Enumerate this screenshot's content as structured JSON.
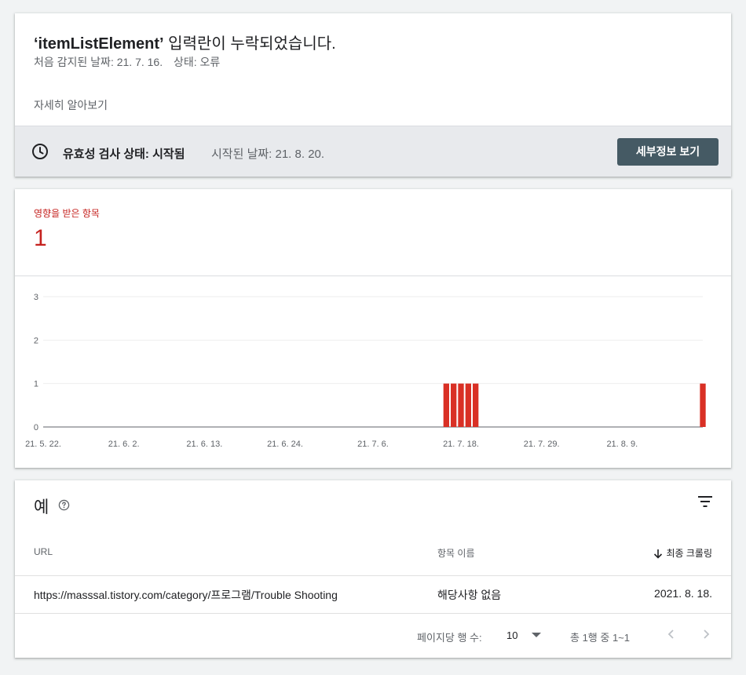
{
  "issue": {
    "title_bold": "‘itemListElement’",
    "title_rest": " 입력란이 누락되었습니다.",
    "first_detected": "처음 감지된 날짜: 21. 7. 16.",
    "status": "상태: 오류",
    "learn_more": "자세히 알아보기"
  },
  "validation": {
    "status": "유효성 검사 상태: 시작됨",
    "started": "시작된 날짜: 21. 8. 20.",
    "details_button": "세부정보 보기",
    "icon": "clock-icon"
  },
  "affected": {
    "label": "영향을 받은 항목",
    "count": "1"
  },
  "chart_data": {
    "type": "bar",
    "title": "",
    "xlabel": "",
    "ylabel": "",
    "ylim": [
      0,
      3
    ],
    "y_ticks": [
      "0",
      "1",
      "2",
      "3"
    ],
    "x_tick_labels": [
      "21. 5. 22.",
      "21. 6. 2.",
      "21. 6. 13.",
      "21. 6. 24.",
      "21. 7. 6.",
      "21. 7. 18.",
      "21. 7. 29.",
      "21. 8. 9."
    ],
    "x_start": "21. 5. 22.",
    "x_end": "21. 8. 20.",
    "bar_color": "#d93025",
    "series": [
      {
        "dates": [
          "21. 7. 16.",
          "21. 7. 17.",
          "21. 7. 18.",
          "21. 7. 19.",
          "21. 7. 20.",
          "21. 8. 20."
        ],
        "values": [
          1,
          1,
          1,
          1,
          1,
          1
        ]
      }
    ],
    "grid": true,
    "legend": "none"
  },
  "examples": {
    "title": "예",
    "columns": {
      "url": "URL",
      "item": "항목 이름",
      "last_crawled": "최종 크롤링"
    },
    "rows": [
      {
        "url": "https://masssal.tistory.com/category/프로그램/Trouble Shooting",
        "item": "해당사항 없음",
        "last_crawled": "2021. 8. 18."
      }
    ],
    "pagination": {
      "rows_per_page_label": "페이지당 행 수:",
      "rows_per_page": "10",
      "range": "총 1행 중 1~1"
    }
  }
}
